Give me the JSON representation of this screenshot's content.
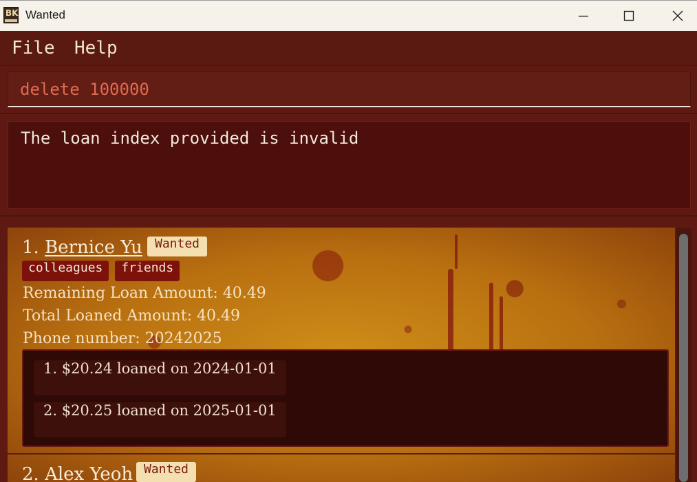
{
  "window": {
    "title": "Wanted",
    "icon": "wanted-list-app-icon",
    "icon_mark": "BK",
    "controls": [
      "minimize-icon",
      "maximize-icon",
      "close-icon"
    ]
  },
  "menu": {
    "items": [
      "File",
      "Help"
    ]
  },
  "command": {
    "value": "delete 100000",
    "text_color": "#e06a52"
  },
  "result": {
    "message": "The loan index provided is invalid"
  },
  "list": {
    "persons": [
      {
        "index": "1.",
        "name": "Bernice Yu",
        "badge": "Wanted",
        "tags": [
          "colleagues",
          "friends"
        ],
        "remaining_loan": "Remaining Loan Amount: 40.49",
        "total_loaned": "Total Loaned Amount: 40.49",
        "phone": "Phone number: 20242025",
        "loans": [
          "1. $20.24 loaned on 2024-01-01",
          "2. $20.25 loaned on 2025-01-01"
        ]
      },
      {
        "index": "2.",
        "name": "Alex Yeoh",
        "badge": "Wanted"
      }
    ]
  },
  "colors": {
    "background": "#5e1a12",
    "result_bg": "#4d0f0b",
    "badge_bg": "#f4dfb0",
    "tag_bg": "#7d120b",
    "card_texture": "#c07a14"
  }
}
